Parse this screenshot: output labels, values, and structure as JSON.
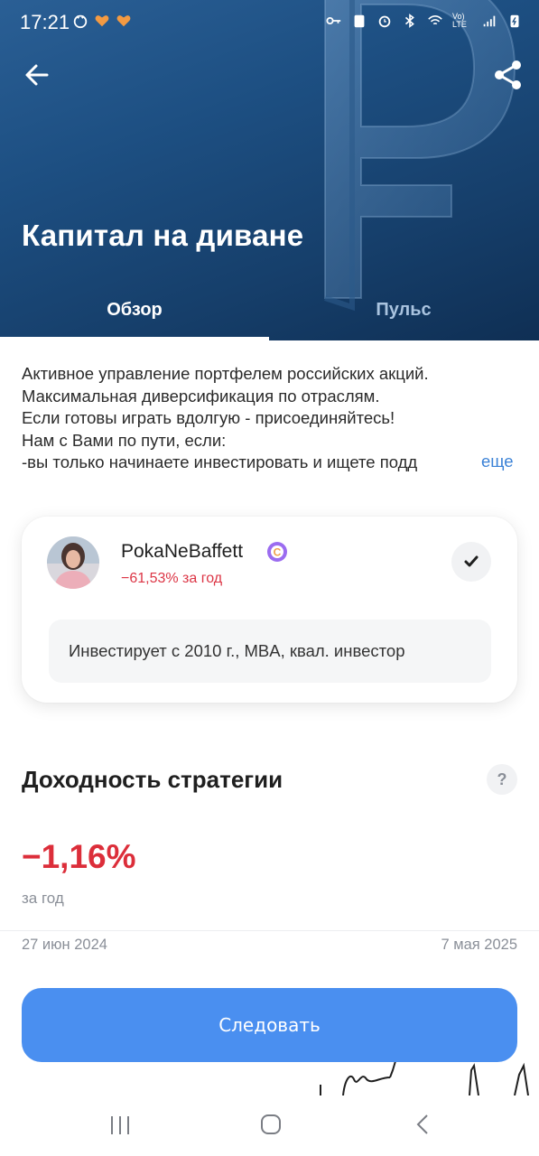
{
  "status_bar": {
    "time": "17:21",
    "network_label": "Vo) LTE",
    "icons_left": [
      "android-icon",
      "heart-icon",
      "heart-icon"
    ],
    "icons_right": [
      "key-icon",
      "clipboard-icon",
      "alarm-icon",
      "bluetooth-icon",
      "wifi-icon",
      "signal-icon",
      "battery-charging-icon"
    ]
  },
  "header": {
    "title": "Капитал на диване",
    "back_icon": "arrow-left-icon",
    "share_icon": "share-icon",
    "background_art": "ruble-symbol"
  },
  "tabs": [
    {
      "label": "Обзор",
      "active": true
    },
    {
      "label": "Пульс",
      "active": false
    }
  ],
  "description": {
    "lines": [
      "Активное управление портфелем российских акций.",
      "Максимальная диверсификация по отраслям.",
      "Если готовы играть вдолгую - присоединяйтесь!",
      "Нам с Вами по пути, если:",
      "-вы только начинаете инвестировать  и ищете подд"
    ],
    "more_label": "еще"
  },
  "author": {
    "name": "PokaNeBaffett",
    "badge_letter": "C",
    "return_text": "−61,53% за год",
    "bio": "Инвестирует с 2010 г., MBA, квал. инвестор",
    "follow_state_icon": "checkmark-icon"
  },
  "strategy": {
    "section_title": "Доходность стратегии",
    "help_label": "?",
    "return_value": "−1,16%",
    "return_period": "за год",
    "date_start": "27 июн 2024",
    "date_end": "7 мая 2025"
  },
  "actions": {
    "follow_label": "Следовать"
  },
  "nav_bar": {
    "icons": [
      "recent-apps-icon",
      "home-icon",
      "back-icon"
    ]
  },
  "colors": {
    "header_bg": "#1d4f82",
    "accent_blue": "#4a8ff0",
    "link_blue": "#3b82d6",
    "negative_red": "#dc2e3a",
    "badge_purple": "#9b6cf0"
  }
}
